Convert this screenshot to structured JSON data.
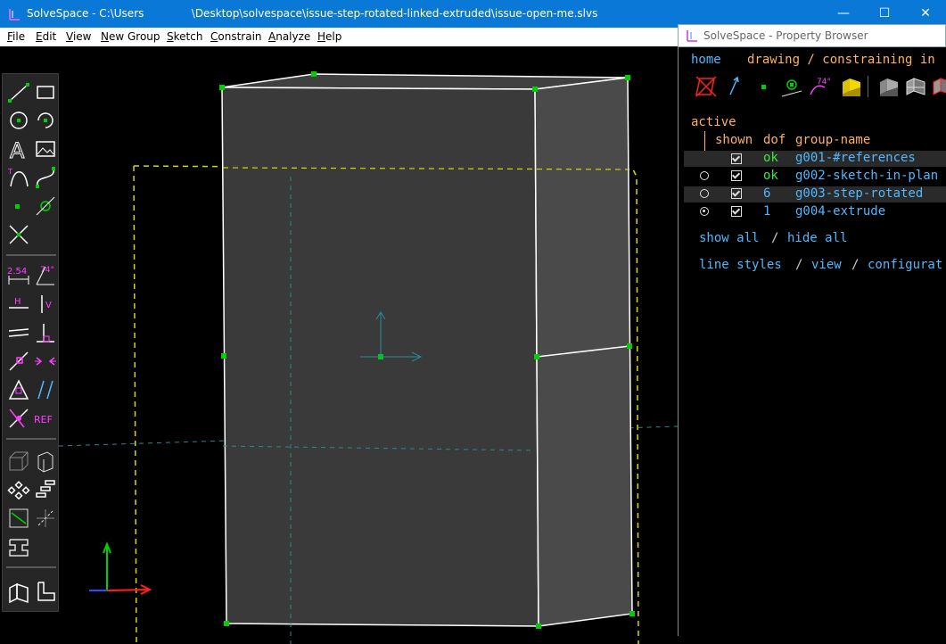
{
  "window": {
    "title": "SolveSpace - C:\\Users              \\Desktop\\solvespace\\issue-step-rotated-linked-extruded\\issue-open-me.slvs",
    "min_label": "—",
    "max_label": "☐",
    "close_label": "✕"
  },
  "menu": {
    "items": [
      {
        "first": "F",
        "rest": "ile"
      },
      {
        "first": "E",
        "rest": "dit"
      },
      {
        "first": "V",
        "rest": "iew"
      },
      {
        "first": "N",
        "rest": "ew Group"
      },
      {
        "first": "S",
        "rest": "ketch"
      },
      {
        "first": "C",
        "rest": "onstrain"
      },
      {
        "first": "A",
        "rest": "nalyze"
      },
      {
        "first": "H",
        "rest": "elp"
      }
    ]
  },
  "toolbar": {
    "dim_label": "2.54",
    "angle_label": "74°",
    "h_label": "H",
    "v_label": "V",
    "ref_label": "REF"
  },
  "property_browser": {
    "title": "SolveSpace - Property Browser",
    "home": "home",
    "breadcrumb": "drawing / constraining in",
    "angle_icon_label": "74°",
    "active_label": "active",
    "headers": {
      "shown": "shown",
      "dof": "dof",
      "name": "group-name"
    },
    "groups": [
      {
        "dof": "ok",
        "name": "g001-#references"
      },
      {
        "dof": "ok",
        "name": "g002-sketch-in-plan"
      },
      {
        "dof": "6",
        "name": "g003-step-rotated"
      },
      {
        "dof": "1",
        "name": "g004-extrude"
      }
    ],
    "show_all": "show all",
    "sep": "/",
    "hide_all": "hide all",
    "line_styles": "line styles",
    "view": "view",
    "configuration": "configurat"
  },
  "colors": {
    "accent_cyan": "#4fb8ff",
    "accent_orange": "#ffb166",
    "ok_green": "#3ce83c",
    "titlebar_blue": "#0a78d7"
  }
}
